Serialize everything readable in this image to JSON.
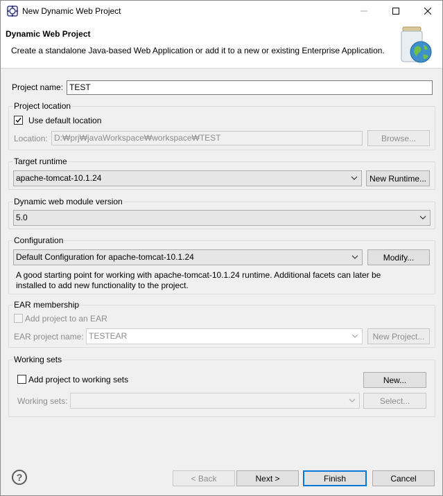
{
  "window": {
    "title": "New Dynamic Web Project",
    "app_icon": "eclipse-icon"
  },
  "banner": {
    "title": "Dynamic Web Project",
    "description": "Create a standalone Java-based Web Application or add it to a new or existing Enterprise Application.",
    "image": "jar-globe-icon"
  },
  "project_name": {
    "label": "Project name:",
    "value": "TEST"
  },
  "project_location": {
    "title": "Project location",
    "use_default_label": "Use default location",
    "use_default_checked": true,
    "location_label": "Location:",
    "location_value": "D:₩prj₩javaWorkspace₩workspace₩TEST",
    "browse_label": "Browse..."
  },
  "target_runtime": {
    "title": "Target runtime",
    "selected": "apache-tomcat-10.1.24",
    "new_runtime_label": "New Runtime..."
  },
  "module_version": {
    "title": "Dynamic web module version",
    "selected": "5.0"
  },
  "configuration": {
    "title": "Configuration",
    "selected": "Default Configuration for apache-tomcat-10.1.24",
    "modify_label": "Modify...",
    "description_line1": "A good starting point for working with apache-tomcat-10.1.24 runtime. Additional facets can later be",
    "description_line2": "installed to add new functionality to the project."
  },
  "ear": {
    "title": "EAR membership",
    "add_label": "Add project to an EAR",
    "add_checked": false,
    "project_name_label": "EAR project name:",
    "project_name_value": "TESTEAR",
    "new_project_label": "New Project..."
  },
  "working_sets": {
    "title": "Working sets",
    "add_label": "Add project to working sets",
    "add_checked": false,
    "new_label": "New...",
    "sets_label": "Working sets:",
    "sets_value": "",
    "select_label": "Select..."
  },
  "footer": {
    "help_icon": "help-icon",
    "help_glyph": "?",
    "back_label": "< Back",
    "next_label": "Next >",
    "finish_label": "Finish",
    "cancel_label": "Cancel"
  },
  "colors": {
    "accent": "#0078d7",
    "checkmark": "#000000"
  }
}
